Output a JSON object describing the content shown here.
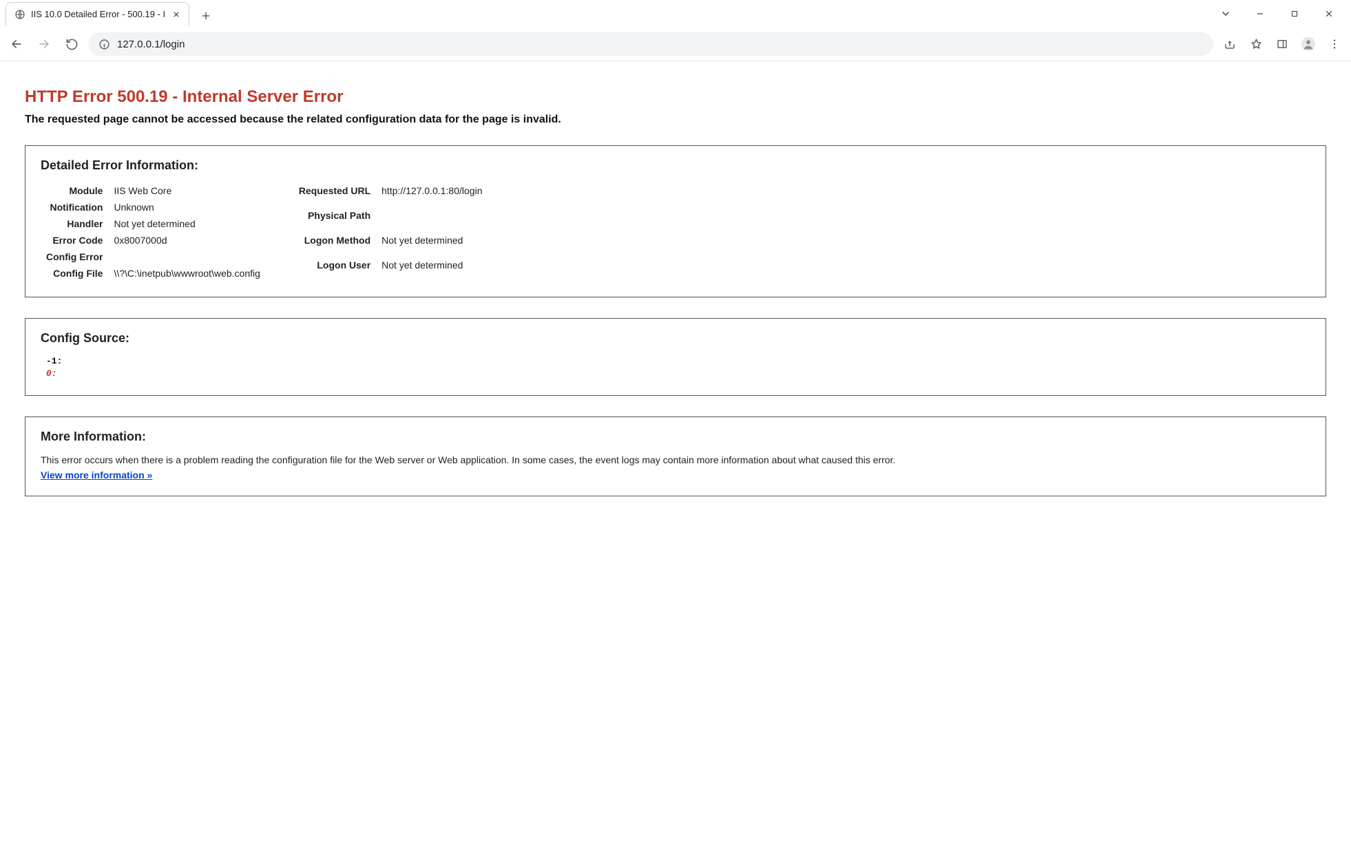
{
  "window": {
    "tab_title": "IIS 10.0 Detailed Error - 500.19 - I"
  },
  "addressbar": {
    "url_text": "127.0.0.1/login"
  },
  "page": {
    "title": "HTTP Error 500.19 - Internal Server Error",
    "subtitle": "The requested page cannot be accessed because the related configuration data for the page is invalid.",
    "detail_heading": "Detailed Error Information:",
    "left_rows": [
      {
        "k": "Module",
        "v": "IIS Web Core"
      },
      {
        "k": "Notification",
        "v": "Unknown"
      },
      {
        "k": "Handler",
        "v": "Not yet determined"
      },
      {
        "k": "Error Code",
        "v": "0x8007000d"
      },
      {
        "k": "Config Error",
        "v": ""
      },
      {
        "k": "Config File",
        "v": "\\\\?\\C:\\inetpub\\wwwroot\\web.config"
      }
    ],
    "right_rows": [
      {
        "k": "Requested URL",
        "v": "http://127.0.0.1:80/login"
      },
      {
        "k": "Physical Path",
        "v": ""
      },
      {
        "k": "Logon Method",
        "v": "Not yet determined"
      },
      {
        "k": "Logon User",
        "v": "Not yet determined"
      }
    ],
    "config_source_heading": "Config Source:",
    "config_source_line1": "-1:",
    "config_source_line2": "0:",
    "more_info_heading": "More Information:",
    "more_info_text": "This error occurs when there is a problem reading the configuration file for the Web server or Web application. In some cases, the event logs may contain more information about what caused this error.",
    "more_info_link": "View more information »"
  }
}
